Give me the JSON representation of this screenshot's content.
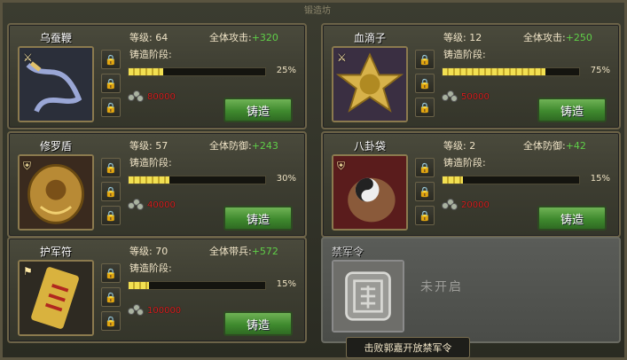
{
  "frame_title": "锻造坊",
  "items": [
    {
      "name": "乌蚕鞭",
      "slot_icon": "sword-slot-icon",
      "level_label": "等级:",
      "level": "64",
      "stat_label": "全体攻击:",
      "stat_value": "+320",
      "stage_label": "铸造阶段:",
      "progress": 0.25,
      "pct": "25%",
      "cost": "80000",
      "button": "铸造"
    },
    {
      "name": "血滴子",
      "slot_icon": "sword-slot-icon",
      "level_label": "等级:",
      "level": "12",
      "stat_label": "全体攻击:",
      "stat_value": "+250",
      "stage_label": "铸造阶段:",
      "progress": 0.75,
      "pct": "75%",
      "cost": "50000",
      "button": "铸造"
    },
    {
      "name": "修罗盾",
      "slot_icon": "shield-slot-icon",
      "level_label": "等级:",
      "level": "57",
      "stat_label": "全体防御:",
      "stat_value": "+243",
      "stage_label": "铸造阶段:",
      "progress": 0.3,
      "pct": "30%",
      "cost": "40000",
      "button": "铸造"
    },
    {
      "name": "八卦袋",
      "slot_icon": "shield-slot-icon",
      "level_label": "等级:",
      "level": "2",
      "stat_label": "全体防御:",
      "stat_value": "+42",
      "stage_label": "铸造阶段:",
      "progress": 0.15,
      "pct": "15%",
      "cost": "20000",
      "button": "铸造"
    },
    {
      "name": "护军符",
      "slot_icon": "flag-slot-icon",
      "level_label": "等级:",
      "level": "70",
      "stat_label": "全体带兵:",
      "stat_value": "+572",
      "stage_label": "铸造阶段:",
      "progress": 0.15,
      "pct": "15%",
      "cost": "100000",
      "button": "铸造"
    }
  ],
  "locked": {
    "name": "禁军令",
    "status": "未开启"
  },
  "tooltip": "击败郭嘉开放禁军令",
  "colors": {
    "accent_green": "#5fce48",
    "cost_red": "#d62020",
    "bar_gold": "#f2e052"
  }
}
